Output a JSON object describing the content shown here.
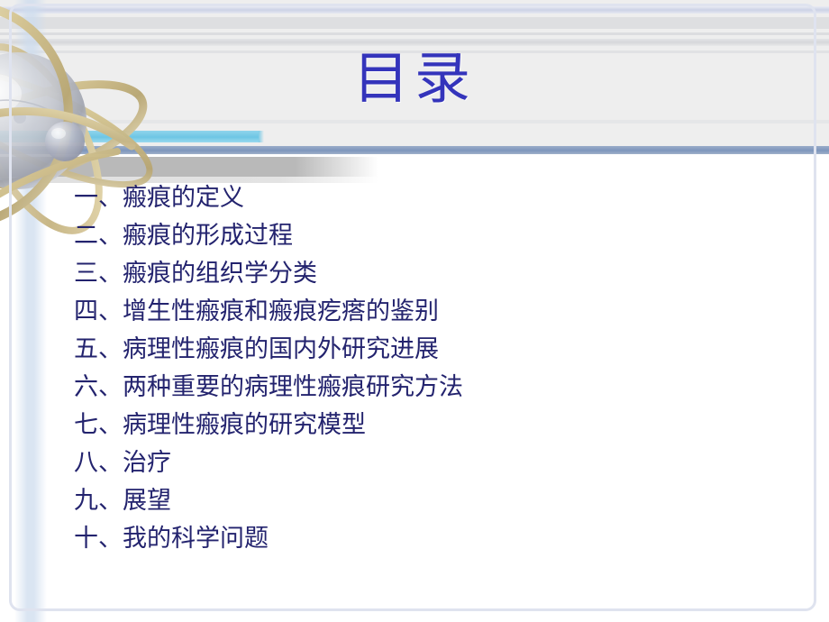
{
  "slide": {
    "title": "目录",
    "title_color": "#3434bb",
    "body_text_color": "#23236e",
    "background_color": "#ffffff",
    "header_band_color": "#eeeeee",
    "accent_cyan": "#6ec6e4",
    "accent_blue_rule": "#7e96bc",
    "accent_grey_band": "#b9b9b9",
    "border_color": "#dfe3ef"
  },
  "decoration": {
    "atom_label": "atom-graphic",
    "sphere_color": "#b9bcc8",
    "orbit_color": "#cdbf91"
  },
  "toc": {
    "items": [
      {
        "num": "一、",
        "label": "瘢痕的定义"
      },
      {
        "num": "二、",
        "label": "瘢痕的形成过程"
      },
      {
        "num": "三、",
        "label": "瘢痕的组织学分类"
      },
      {
        "num": "四、",
        "label": "增生性瘢痕和瘢痕疙瘩的鉴别"
      },
      {
        "num": "五、",
        "label": "病理性瘢痕的国内外研究进展"
      },
      {
        "num": "六、",
        "label": "两种重要的病理性瘢痕研究方法"
      },
      {
        "num": "七、",
        "label": "病理性瘢痕的研究模型"
      },
      {
        "num": "八、",
        "label": "治疗"
      },
      {
        "num": "九、",
        "label": "展望"
      },
      {
        "num": "十、",
        "label": "我的科学问题"
      }
    ]
  }
}
